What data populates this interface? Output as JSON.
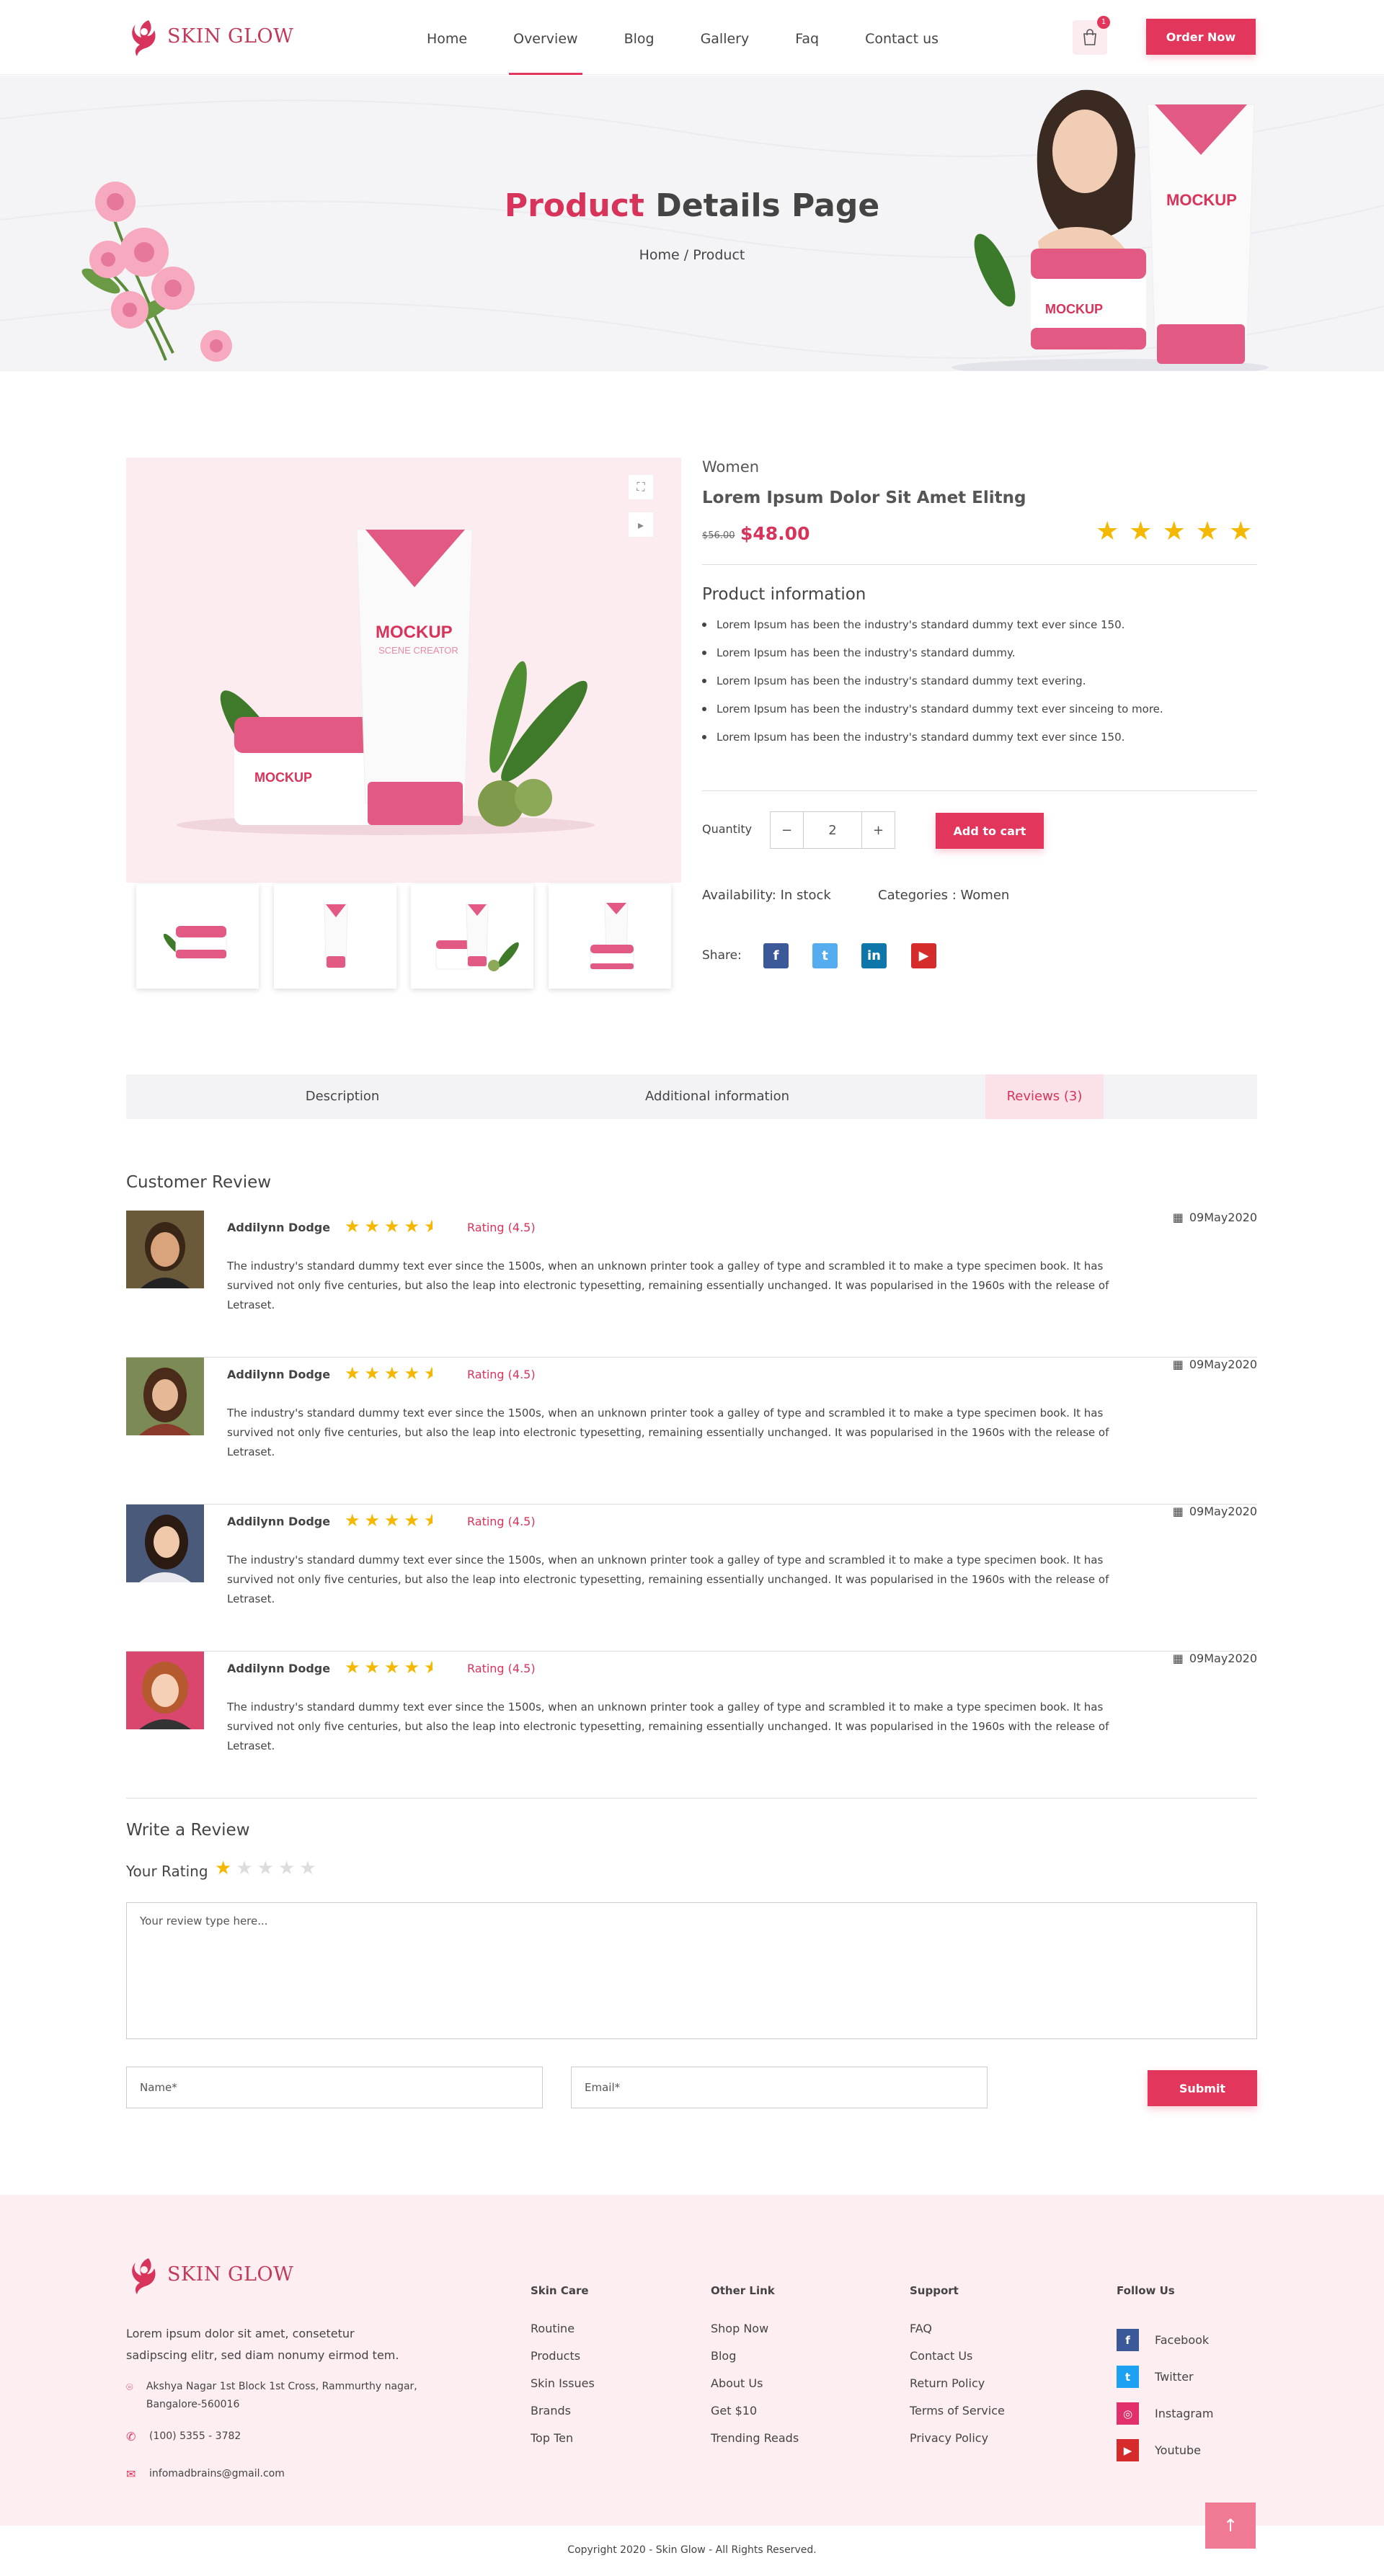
{
  "brand": {
    "name": "SKIN GLOW",
    "accent": "#e2365c"
  },
  "nav": {
    "items": [
      {
        "label": "Home"
      },
      {
        "label": "Overview",
        "active": true
      },
      {
        "label": "Blog"
      },
      {
        "label": "Gallery"
      },
      {
        "label": "Faq"
      },
      {
        "label": "Contact us"
      }
    ],
    "cart_count": "1",
    "order_label": "Order Now"
  },
  "hero": {
    "title_accent": "Product",
    "title_rest": "Details Page",
    "breadcrumb": "Home / Product"
  },
  "product": {
    "category": "Women",
    "name": "Lorem Ipsum Dolor Sit Amet Elitng",
    "old_price": "$56.00",
    "price": "$48.00",
    "rating_stars": 5,
    "info_title": "Product information",
    "info": [
      "Lorem Ipsum has been the industry's standard dummy text ever since 150.",
      "Lorem Ipsum has been the industry's standard dummy.",
      "Lorem Ipsum has been the industry's standard dummy text evering.",
      "Lorem Ipsum has been the industry's standard dummy text ever sinceing to more.",
      "Lorem Ipsum has been the industry's standard dummy text ever since 150."
    ],
    "quantity_label": "Quantity",
    "quantity": "2",
    "add_to_cart": "Add to cart",
    "availability": "Availability: In stock",
    "categories": "Categories : Women",
    "share_label": "Share:"
  },
  "tabs": [
    {
      "label": "Description"
    },
    {
      "label": "Additional information"
    },
    {
      "label": "Reviews (3)",
      "active": true
    }
  ],
  "reviews": {
    "title": "Customer Review",
    "items": [
      {
        "name": "Addilynn Dodge",
        "stars": 4.5,
        "rating": "Rating (4.5)",
        "date": "09May2020",
        "text": "The industry's standard dummy text ever since the 1500s, when an unknown printer took a galley of type and scrambled it to make a type specimen book. It has survived not only five centuries, but also the leap into electronic typesetting, remaining essentially unchanged. It was popularised in the 1960s with the release of Letraset."
      },
      {
        "name": "Addilynn Dodge",
        "stars": 4.5,
        "rating": "Rating (4.5)",
        "date": "09May2020",
        "text": "The industry's standard dummy text ever since the 1500s, when an unknown printer took a galley of type and scrambled it to make a type specimen book. It has survived not only five centuries, but also the leap into electronic typesetting, remaining essentially unchanged. It was popularised in the 1960s with the release of Letraset."
      },
      {
        "name": "Addilynn Dodge",
        "stars": 4.5,
        "rating": "Rating (4.5)",
        "date": "09May2020",
        "text": "The industry's standard dummy text ever since the 1500s, when an unknown printer took a galley of type and scrambled it to make a type specimen book. It has survived not only five centuries, but also the leap into electronic typesetting, remaining essentially unchanged. It was popularised in the 1960s with the release of Letraset."
      },
      {
        "name": "Addilynn Dodge",
        "stars": 4.5,
        "rating": "Rating (4.5)",
        "date": "09May2020",
        "text": "The industry's standard dummy text ever since the 1500s, when an unknown printer took a galley of type and scrambled it to make a type specimen book. It has survived not only five centuries, but also the leap into electronic typesetting, remaining essentially unchanged. It was popularised in the 1960s with the release of Letraset."
      }
    ]
  },
  "write_review": {
    "title": "Write a Review",
    "your_rating": "Your Rating",
    "selected_stars": 1,
    "textarea_placeholder": "Your review type here...",
    "name_placeholder": "Name*",
    "email_placeholder": "Email*",
    "submit": "Submit"
  },
  "footer": {
    "about": "Lorem ipsum dolor sit amet, consetetur sadipscing elitr, sed diam nonumy eirmod tem.",
    "address": "Akshya Nagar 1st Block 1st Cross, Rammurthy nagar, Bangalore-560016",
    "phone": "(100) 5355 - 3782",
    "email": "infomadbrains@gmail.com",
    "columns": [
      {
        "title": "Skin Care",
        "links": [
          "Routine",
          "Products",
          "Skin Issues",
          "Brands",
          "Top Ten"
        ]
      },
      {
        "title": "Other Link",
        "links": [
          "Shop Now",
          "Blog",
          "About Us",
          "Get $10",
          "Trending Reads"
        ]
      },
      {
        "title": "Support",
        "links": [
          "FAQ",
          "Contact Us",
          "Return Policy",
          "Terms of Service",
          "Privacy Policy"
        ]
      }
    ],
    "follow": {
      "title": "Follow Us",
      "items": [
        {
          "label": "Facebook",
          "icon": "facebook-icon",
          "color": "#3b5998"
        },
        {
          "label": "Twitter",
          "icon": "twitter-icon",
          "color": "#1da1f2"
        },
        {
          "label": "Instagram",
          "icon": "instagram-icon",
          "color": "#e1306c"
        },
        {
          "label": "Youtube",
          "icon": "youtube-icon",
          "color": "#d62b2b"
        }
      ]
    },
    "copyright": "Copyright 2020 - Skin Glow - All Rights Reserved."
  }
}
